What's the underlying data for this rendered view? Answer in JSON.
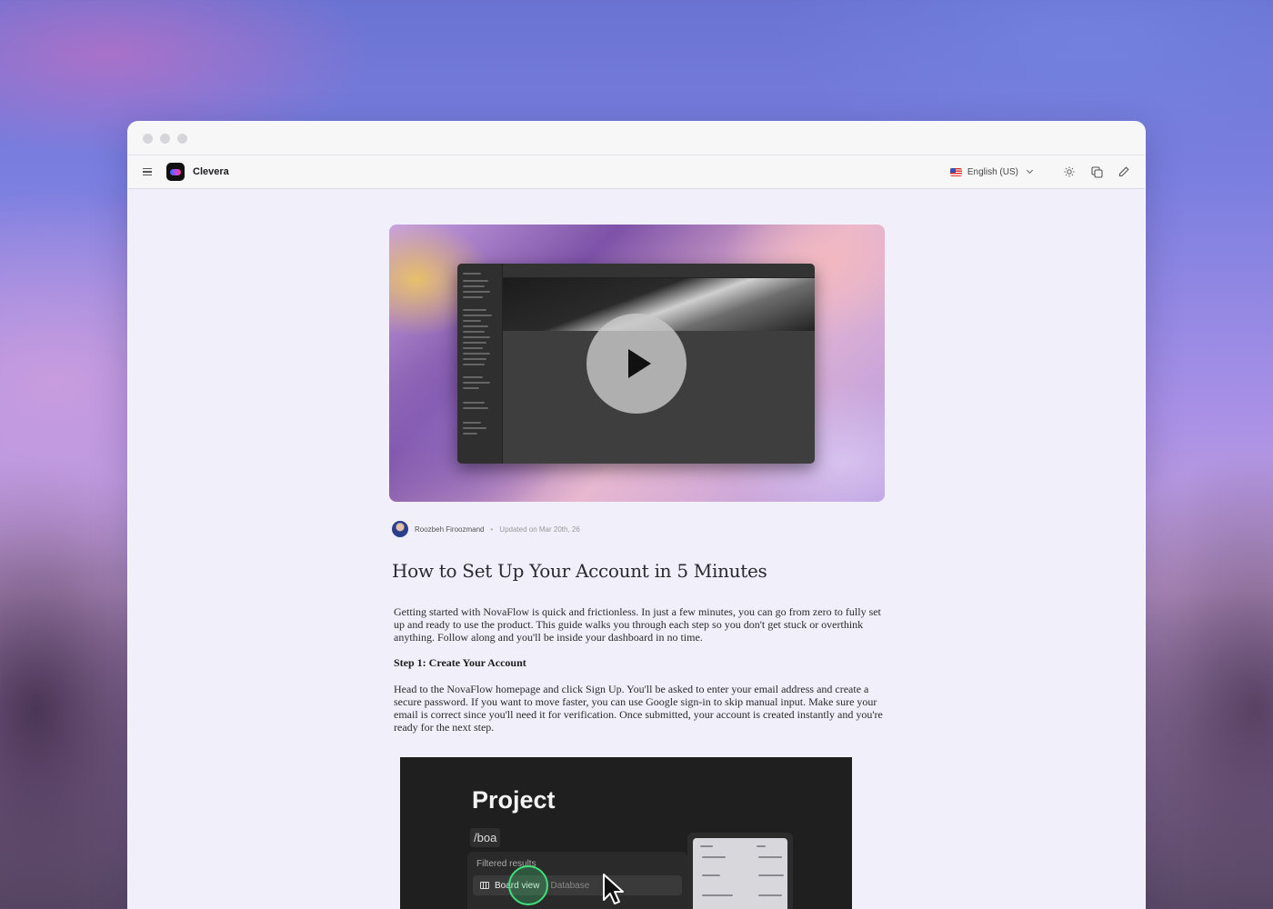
{
  "app": {
    "brand": "Clevera",
    "language": "English (US)"
  },
  "article": {
    "author": "Roozbeh Firoozmand",
    "updated": "Updated on Mar 20th, 26",
    "title": "How to Set Up Your Account in 5 Minutes",
    "intro": "Getting started with NovaFlow is quick and frictionless. In just a few minutes, you can go from zero to fully set up and ready to use the product. This guide walks you through each step so you don't get stuck or overthink anything. Follow along and you'll be inside your dashboard in no time.",
    "step1_heading": "Step 1: Create Your Account",
    "step1_body": "Head to the NovaFlow homepage and click Sign Up. You'll be asked to enter your email address and create a secure password. If you want to move faster, you can use Google sign-in to skip manual input. Make sure your email is correct since you'll need it for verification. Once submitted, your account is created instantly and you're ready for the next step."
  },
  "screenshot": {
    "title": "Project",
    "slash_command": "/boa",
    "filter_title": "Filtered results",
    "option_board": "Board view",
    "option_database": "Database"
  },
  "icons": {
    "menu": "hamburger-menu-icon",
    "theme": "sun-icon",
    "copy": "copy-icon",
    "edit": "pencil-icon",
    "play": "play-icon"
  }
}
